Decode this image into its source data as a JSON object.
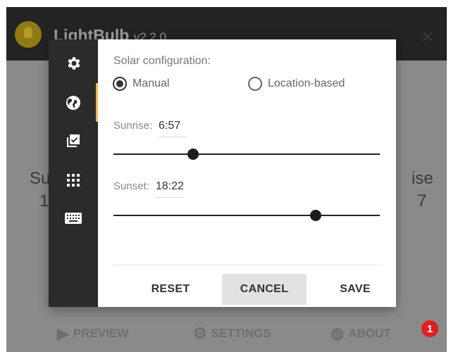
{
  "app": {
    "title": "LightBulb",
    "version": "v2.2.0",
    "close_icon": "close-icon",
    "background": {
      "sunrise_label": "Su",
      "sunrise_value": "18",
      "sunset_label": "ise",
      "sunset_value": "7"
    },
    "nav": [
      {
        "label": "PREVIEW",
        "icon": "play-circle-icon"
      },
      {
        "label": "SETTINGS",
        "icon": "gear-icon"
      },
      {
        "label": "ABOUT",
        "icon": "globe-icon"
      }
    ],
    "notification_count": "1"
  },
  "dialog": {
    "sidebar": [
      {
        "icon": "gear-icon"
      },
      {
        "icon": "globe-icon",
        "active": true
      },
      {
        "icon": "checkbox-icon"
      },
      {
        "icon": "apps-grid-icon"
      },
      {
        "icon": "keyboard-icon"
      }
    ],
    "solar_label": "Solar configuration:",
    "mode_options": [
      {
        "label": "Manual",
        "checked": true
      },
      {
        "label": "Location-based",
        "checked": false
      }
    ],
    "sunrise": {
      "label": "Sunrise:",
      "value": "6:57",
      "slider_level": 0.3
    },
    "sunset": {
      "label": "Sunset:",
      "value": "18:22",
      "slider_level": 0.76
    },
    "buttons": {
      "reset": "RESET",
      "cancel": "CANCEL",
      "save": "SAVE"
    }
  },
  "colors": {
    "accent": "#f2b84b",
    "sidebar_bg": "#2b2b2b",
    "titlebar_bg": "#232323",
    "badge": "#e01f1f"
  }
}
